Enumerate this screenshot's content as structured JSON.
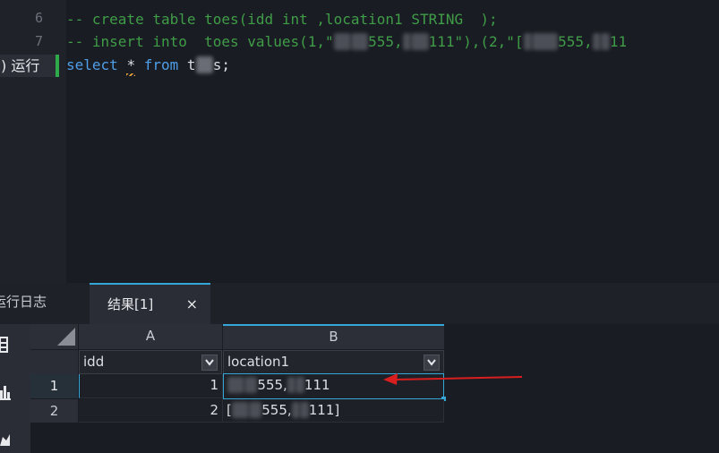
{
  "editor": {
    "lines": [
      {
        "number": "6",
        "code": "-- create table toes(idd int ,location1 STRING  );"
      },
      {
        "number": "7",
        "code_prefix": "-- insert into  toes values(1,\"",
        "blur_1": "11",
        "code_mid1": "555,",
        "blur_2": "1",
        "code_mid2": "111\"),(2,\"[",
        "blur_3": "1",
        "code_mid3": "555,",
        "blur_4": "1",
        "code_end": "11"
      },
      {
        "number": "",
        "kw1": "select",
        "star": "*",
        "kw2": "from",
        "table_visible": "t",
        "table_blur": "oe",
        "table_end": "s;"
      }
    ],
    "run_button": {
      "paren": ")",
      "label": "运行"
    }
  },
  "tabs": {
    "log_label": "运行日志",
    "result_label": "结果[1]",
    "close_label": "×"
  },
  "grid": {
    "col_headers": [
      "A",
      "B"
    ],
    "filters": [
      "idd",
      "location1"
    ],
    "rows": [
      {
        "num": "1",
        "idd": "1",
        "loc_blur": "11",
        "loc_mid": "555,",
        "loc_blur2": "1",
        "loc_end": "111"
      },
      {
        "num": "2",
        "idd": "2",
        "loc_pre": "[",
        "loc_blur": "11",
        "loc_mid": "555,",
        "loc_blur2": "1",
        "loc_end": "111]"
      }
    ]
  },
  "colors": {
    "accent": "#35a7d6",
    "run_indicator": "#2faa4a",
    "arrow": "#d81e1e",
    "comment": "#3f9c47",
    "keyword": "#4f9ee8"
  }
}
